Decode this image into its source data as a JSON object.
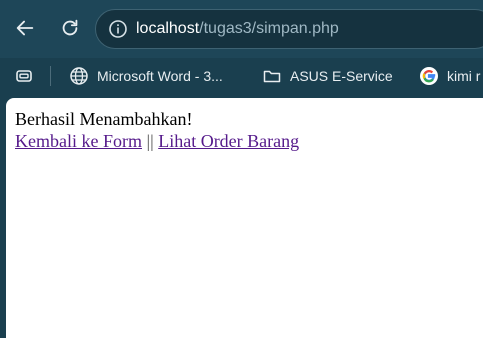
{
  "browser": {
    "address_bar": {
      "host": "localhost",
      "path": "/tugas3/simpan.php"
    },
    "buttons": {
      "back": "back-arrow-icon",
      "reload": "reload-icon"
    },
    "bookmarks": [
      {
        "label": "",
        "icon": "tab-groups-icon"
      },
      {
        "label": "Microsoft Word - 3...",
        "icon": "globe-icon"
      },
      {
        "label": "ASUS E-Service",
        "icon": "folder-icon"
      },
      {
        "label": "kimi r",
        "icon": "google-icon"
      }
    ]
  },
  "page": {
    "message": "Berhasil Menambahkan!",
    "link_back": "Kembali ke Form",
    "separator": "||",
    "link_orders": "Lihat Order Barang",
    "link_color": "#551a8b"
  }
}
